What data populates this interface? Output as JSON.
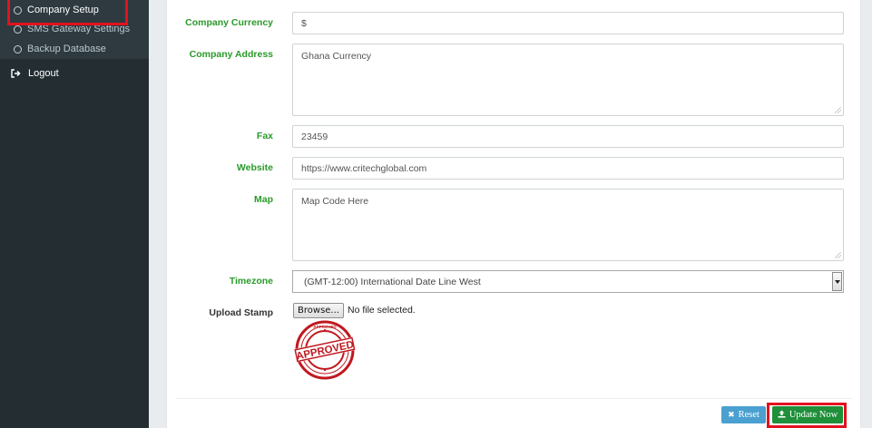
{
  "sidebar": {
    "submenu": [
      {
        "label": "Company Setup",
        "active": true
      },
      {
        "label": "SMS Gateway Settings",
        "active": false
      },
      {
        "label": "Backup Database",
        "active": false
      }
    ],
    "logout_label": "Logout",
    "icons": {
      "submenu": "circle-outline-icon",
      "logout": "sign-out-icon"
    }
  },
  "form": {
    "currency": {
      "label": "Company Currency",
      "value": "$"
    },
    "address": {
      "label": "Company Address",
      "value": "Ghana Currency"
    },
    "fax": {
      "label": "Fax",
      "value": "23459"
    },
    "website": {
      "label": "Website",
      "value": "https://www.critechglobal.com"
    },
    "map": {
      "label": "Map",
      "value": "Map Code Here"
    },
    "timezone": {
      "label": "Timezone",
      "value": "(GMT-12:00) International Date Line West"
    },
    "stamp": {
      "label": "Upload Stamp",
      "browse_label": "Browse...",
      "no_file_text": "No file selected.",
      "image_text": "APPROVED",
      "image_ring_text": "APPROVED"
    }
  },
  "actions": {
    "reset_label": "Reset",
    "update_label": "Update Now"
  },
  "colors": {
    "label_green": "#2a9a2a",
    "highlight_red": "#e2121f",
    "reset_blue": "#4aa0d0",
    "update_green": "#1f8f3a",
    "sidebar_bg": "#232d32",
    "stamp_red": "#c0181f"
  }
}
